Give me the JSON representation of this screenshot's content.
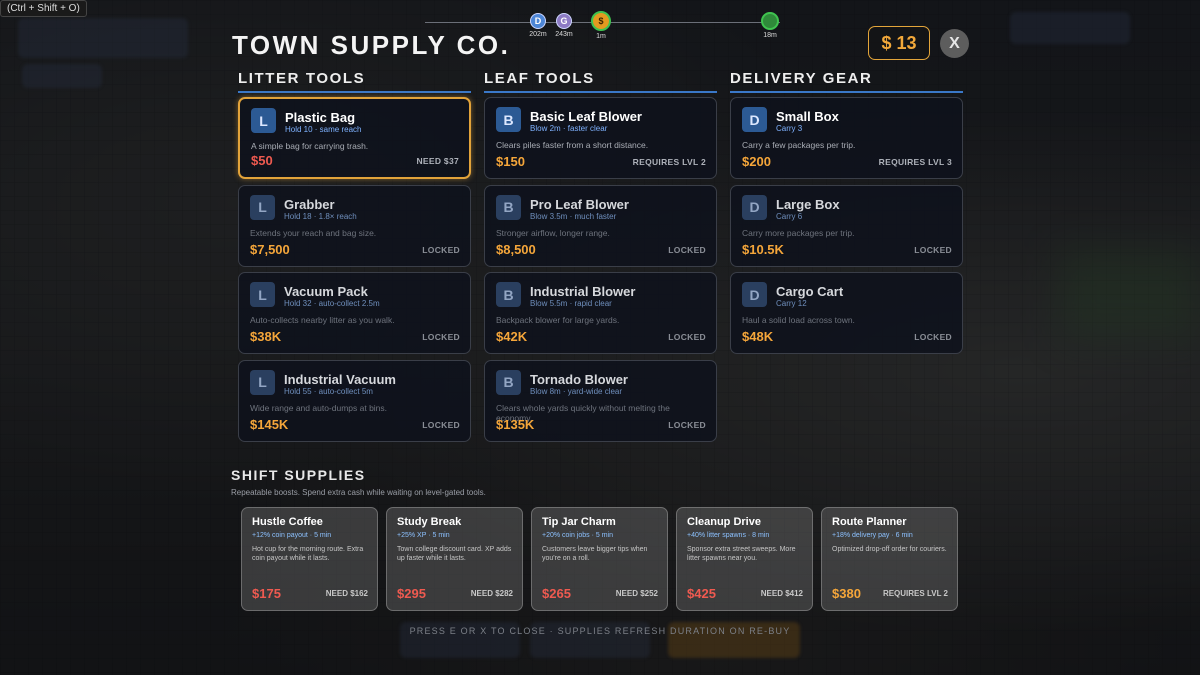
{
  "hint": "(Ctrl + Shift + O)",
  "title": "TOWN SUPPLY CO.",
  "progress_track": {
    "markers": [
      {
        "letter": "D",
        "label": "202m",
        "color": "#4d86d6"
      },
      {
        "letter": "G",
        "label": "243m",
        "color": "#8d7bc4"
      },
      {
        "letter": "$",
        "label": "1m",
        "color": "#e39a20"
      },
      {
        "letter": "",
        "label": "18m",
        "color": "#2f8a3a"
      }
    ]
  },
  "money": "$ 13",
  "close_label": "X",
  "columns": [
    {
      "header": "LITTER TOOLS",
      "items": [
        {
          "badge": "L",
          "name": "Plastic Bag",
          "stat": "Hold 10 · same reach",
          "desc": "A simple bag for carrying trash.",
          "price": "$50",
          "req": "NEED $37",
          "state": "selected"
        },
        {
          "badge": "L",
          "name": "Grabber",
          "stat": "Hold 18 · 1.8× reach",
          "desc": "Extends your reach and bag size.",
          "price": "$7,500",
          "req": "LOCKED",
          "state": "locked"
        },
        {
          "badge": "L",
          "name": "Vacuum Pack",
          "stat": "Hold 32 · auto-collect 2.5m",
          "desc": "Auto-collects nearby litter as you walk.",
          "price": "$38K",
          "req": "LOCKED",
          "state": "locked"
        },
        {
          "badge": "L",
          "name": "Industrial Vacuum",
          "stat": "Hold 55 · auto-collect 5m",
          "desc": "Wide range and auto-dumps at bins.",
          "price": "$145K",
          "req": "LOCKED",
          "state": "locked"
        }
      ]
    },
    {
      "header": "LEAF TOOLS",
      "items": [
        {
          "badge": "B",
          "name": "Basic Leaf Blower",
          "stat": "Blow 2m · faster clear",
          "desc": "Clears piles faster from a short distance.",
          "price": "$150",
          "req": "REQUIRES LVL 2",
          "state": "gated"
        },
        {
          "badge": "B",
          "name": "Pro Leaf Blower",
          "stat": "Blow 3.5m · much faster",
          "desc": "Stronger airflow, longer range.",
          "price": "$8,500",
          "req": "LOCKED",
          "state": "locked"
        },
        {
          "badge": "B",
          "name": "Industrial Blower",
          "stat": "Blow 5.5m · rapid clear",
          "desc": "Backpack blower for large yards.",
          "price": "$42K",
          "req": "LOCKED",
          "state": "locked"
        },
        {
          "badge": "B",
          "name": "Tornado Blower",
          "stat": "Blow 8m · yard-wide clear",
          "desc": "Clears whole yards quickly without melting the economy.",
          "price": "$135K",
          "req": "LOCKED",
          "state": "locked"
        }
      ]
    },
    {
      "header": "DELIVERY GEAR",
      "items": [
        {
          "badge": "D",
          "name": "Small Box",
          "stat": "Carry 3",
          "desc": "Carry a few packages per trip.",
          "price": "$200",
          "req": "REQUIRES LVL 3",
          "state": "gated"
        },
        {
          "badge": "D",
          "name": "Large Box",
          "stat": "Carry 6",
          "desc": "Carry more packages per trip.",
          "price": "$10.5K",
          "req": "LOCKED",
          "state": "locked"
        },
        {
          "badge": "D",
          "name": "Cargo Cart",
          "stat": "Carry 12",
          "desc": "Haul a solid load across town.",
          "price": "$48K",
          "req": "LOCKED",
          "state": "locked"
        }
      ]
    }
  ],
  "supplies": {
    "header": "SHIFT SUPPLIES",
    "subtitle": "Repeatable boosts. Spend extra cash while waiting on level-gated tools.",
    "items": [
      {
        "name": "Hustle Coffee",
        "stat": "+12% coin payout · 5 min",
        "desc": "Hot cup for the morning route. Extra coin payout while it lasts.",
        "price": "$175",
        "req": "NEED $162",
        "affordable": false
      },
      {
        "name": "Study Break",
        "stat": "+25% XP · 5 min",
        "desc": "Town college discount card. XP adds up faster while it lasts.",
        "price": "$295",
        "req": "NEED $282",
        "affordable": false
      },
      {
        "name": "Tip Jar Charm",
        "stat": "+20% coin jobs · 5 min",
        "desc": "Customers leave bigger tips when you're on a roll.",
        "price": "$265",
        "req": "NEED $252",
        "affordable": false
      },
      {
        "name": "Cleanup Drive",
        "stat": "+40% litter spawns · 8 min",
        "desc": "Sponsor extra street sweeps. More litter spawns near you.",
        "price": "$425",
        "req": "NEED $412",
        "affordable": false
      },
      {
        "name": "Route Planner",
        "stat": "+18% delivery pay · 6 min",
        "desc": "Optimized drop-off order for couriers.",
        "price": "$380",
        "req": "REQUIRES LVL 2",
        "affordable": "gated"
      }
    ]
  },
  "footer": "PRESS E OR X TO CLOSE · SUPPLIES REFRESH DURATION ON RE-BUY"
}
